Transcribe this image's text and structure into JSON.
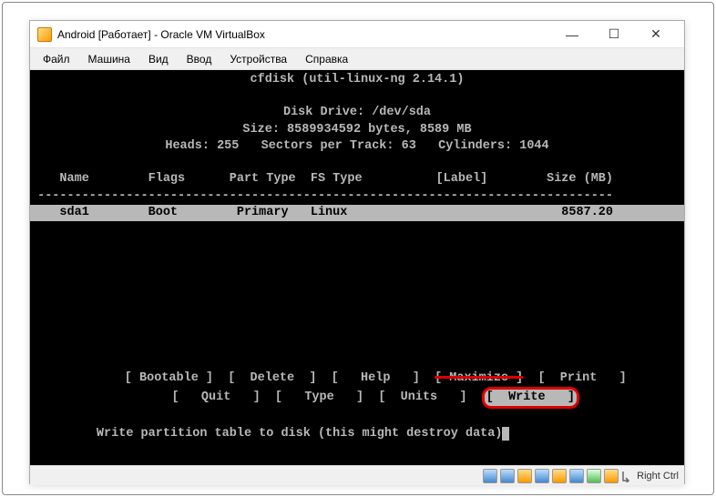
{
  "window": {
    "title": "Android [Работает] - Oracle VM VirtualBox",
    "minimize": "—",
    "maximize": "☐",
    "close": "✕"
  },
  "menubar": {
    "file": "Файл",
    "machine": "Машина",
    "view": "Вид",
    "input": "Ввод",
    "devices": "Устройства",
    "help": "Справка"
  },
  "cfdisk": {
    "header": "cfdisk (util-linux-ng 2.14.1)",
    "drive": "Disk Drive: /dev/sda",
    "size": "Size: 8589934592 bytes, 8589 MB",
    "geometry": "Heads: 255   Sectors per Track: 63   Cylinders: 1044",
    "columns": "    Name        Flags      Part Type  FS Type          [Label]        Size (MB)",
    "divider": " ------------------------------------------------------------------------------",
    "row1": "    sda1        Boot        Primary   Linux                             8587.20 ",
    "menu1_pre": "     [ Bootable ]  [  Delete  ]  [   Help   ]  ",
    "menu1_max": "[ Maximize ]",
    "menu1_post": "  [  Print   ]",
    "menu2_pre": "     [   Quit   ]  [   Type   ]  [  Units   ]  ",
    "menu2_write": "[  Write   ]",
    "prompt": "         Write partition table to disk (this might destroy data)"
  },
  "statusbar": {
    "hostkey": "Right Ctrl"
  }
}
